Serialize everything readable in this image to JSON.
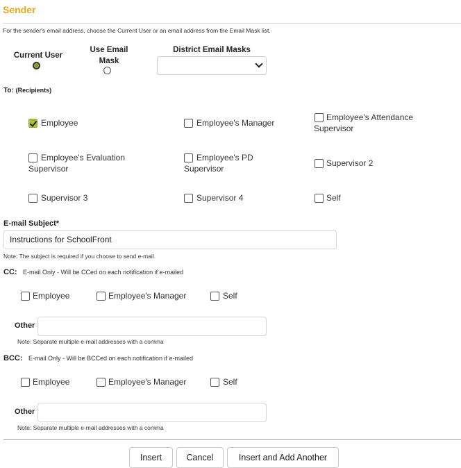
{
  "sender": {
    "title": "Sender",
    "hint": "For the sender's email address, choose the Current User or an email address from the Email Mask list.",
    "current_user_label": "Current User",
    "use_email_mask_label_line1": "Use Email",
    "use_email_mask_label_line2": "Mask",
    "district_masks_label": "District Email Masks",
    "district_masks_value": ""
  },
  "to": {
    "label": "To:",
    "sublabel": "(Recipients)",
    "options": {
      "employee": "Employee",
      "employees_manager": "Employee's Manager",
      "attendance_line1": "Employee's Attendance",
      "attendance_line2": "Supervisor",
      "evaluation_line1": "Employee's Evaluation",
      "evaluation_line2": "Supervisor",
      "pd_line1": "Employee's PD",
      "pd_line2": "Supervisor",
      "supervisor2": "Supervisor 2",
      "supervisor3": "Supervisor 3",
      "supervisor4": "Supervisor 4",
      "self": "Self"
    }
  },
  "subject": {
    "label": "E-mail Subject*",
    "value": "Instructions for SchoolFront",
    "note": "Note: The subject is required if you choose to send e-mail."
  },
  "cc": {
    "label": "CC:",
    "hint": "E-mail Only - Will be CCed on each notification if e-mailed",
    "employee": "Employee",
    "employees_manager": "Employee's Manager",
    "self": "Self",
    "other_label": "Other",
    "other_value": "",
    "note": "Note: Separate multiple e-mail addresses with a comma"
  },
  "bcc": {
    "label": "BCC:",
    "hint": "E-mail Only - Will be BCCed on each notification if e-mailed",
    "employee": "Employee",
    "employees_manager": "Employee's Manager",
    "self": "Self",
    "other_label": "Other",
    "other_value": "",
    "note": "Note: Separate multiple e-mail addresses with a comma"
  },
  "buttons": {
    "insert": "Insert",
    "cancel": "Cancel",
    "insert_add": "Insert and Add Another"
  },
  "colors": {
    "accent": "#f2a71b",
    "check": "#a7c53a"
  }
}
